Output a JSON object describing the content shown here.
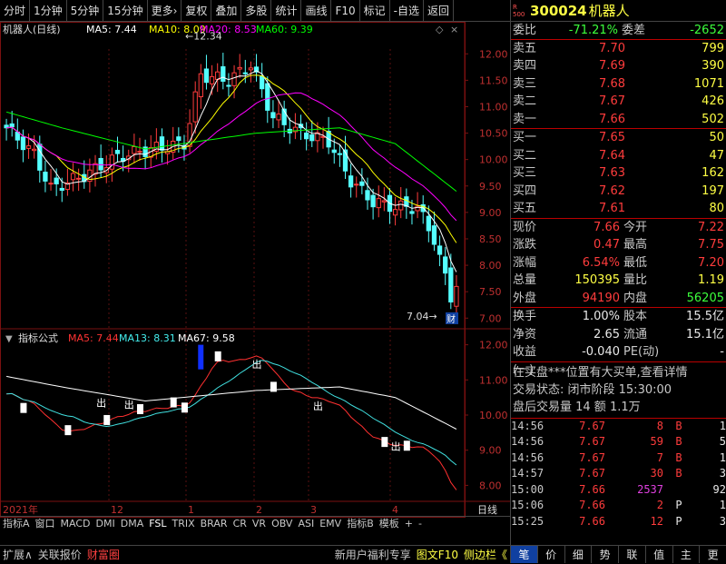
{
  "toolbar": {
    "items": [
      "分时",
      "1分钟",
      "5分钟",
      "15分钟",
      "更多›",
      "复权",
      "叠加",
      "多股",
      "统计",
      "画线",
      "F10",
      "标记",
      "-自选",
      "返回"
    ]
  },
  "main": {
    "title": "机器人(日线)",
    "ma5": "MA5: 7.44",
    "ma10": "MA10: 8.09",
    "ma20": "MA20: 8.53",
    "ma60": "MA60: 9.39",
    "yticks": [
      "12.00",
      "11.50",
      "11.00",
      "10.50",
      "10.00",
      "9.50",
      "9.00",
      "8.50",
      "8.00",
      "7.50",
      "7.00"
    ],
    "high_label": "12.34",
    "low_label": "7.04",
    "cai_label": "财"
  },
  "sub": {
    "title": "指标公式",
    "ma5": "MA5: 7.44",
    "ma13": "MA13: 8.31",
    "ma67": "MA67: 9.58",
    "yticks": [
      "12.00",
      "11.00",
      "10.00",
      "9.00",
      "8.00"
    ],
    "out_label": "出"
  },
  "xaxis": {
    "labels": [
      "2021年",
      "12",
      "1",
      "2",
      "3",
      "4"
    ],
    "period": "日线"
  },
  "tabbar": [
    "指标A",
    "窗口",
    "MACD",
    "DMI",
    "DMA",
    "FSL",
    "TRIX",
    "BRAR",
    "CR",
    "VR",
    "OBV",
    "ASI",
    "EMV",
    "指标B",
    "模板",
    "+",
    "-"
  ],
  "bottombar": {
    "left": [
      "扩展∧",
      "关联报价",
      "财富圈"
    ],
    "right": [
      "新用户福利专享",
      "图文F10",
      "侧边栏《"
    ]
  },
  "stock": {
    "badge": "R 500",
    "code": "300024",
    "name": "机器人"
  },
  "weibi": {
    "label": "委比",
    "value": "-71.21%",
    "label2": "委差",
    "value2": "-2652"
  },
  "sells": [
    {
      "l": "卖五",
      "p": "7.70",
      "v": "799"
    },
    {
      "l": "卖四",
      "p": "7.69",
      "v": "390"
    },
    {
      "l": "卖三",
      "p": "7.68",
      "v": "1071"
    },
    {
      "l": "卖二",
      "p": "7.67",
      "v": "426"
    },
    {
      "l": "卖一",
      "p": "7.66",
      "v": "502"
    }
  ],
  "buys": [
    {
      "l": "买一",
      "p": "7.65",
      "v": "50"
    },
    {
      "l": "买二",
      "p": "7.64",
      "v": "47"
    },
    {
      "l": "买三",
      "p": "7.63",
      "v": "162"
    },
    {
      "l": "买四",
      "p": "7.62",
      "v": "197"
    },
    {
      "l": "买五",
      "p": "7.61",
      "v": "80"
    }
  ],
  "quote": [
    {
      "a": "现价",
      "av": "7.66",
      "b": "今开",
      "bv": "7.22"
    },
    {
      "a": "涨跌",
      "av": "0.47",
      "b": "最高",
      "bv": "7.75"
    },
    {
      "a": "涨幅",
      "av": "6.54%",
      "b": "最低",
      "bv": "7.20"
    },
    {
      "a": "总量",
      "av": "150395",
      "b": "量比",
      "bv": "1.19"
    },
    {
      "a": "外盘",
      "av": "94190",
      "b": "内盘",
      "bv": "56205"
    }
  ],
  "fund": [
    {
      "a": "换手",
      "av": "1.00%",
      "b": "股本",
      "bv": "15.5亿"
    },
    {
      "a": "净资",
      "av": "2.65",
      "b": "流通",
      "bv": "15.1亿"
    },
    {
      "a": "收益(一)",
      "av": "-0.040",
      "b": "PE(动)",
      "bv": "-"
    }
  ],
  "notice": "在买盘***位置有大买单,查看详情",
  "status": "交易状态: 闭市阶段 15:30:00",
  "after": "盘后交易量 14 额 1.1万",
  "trades": [
    {
      "t": "14:56",
      "p": "7.67",
      "v": "8",
      "s": "B",
      "n": "1"
    },
    {
      "t": "14:56",
      "p": "7.67",
      "v": "59",
      "s": "B",
      "n": "5"
    },
    {
      "t": "14:56",
      "p": "7.67",
      "v": "7",
      "s": "B",
      "n": "1"
    },
    {
      "t": "14:57",
      "p": "7.67",
      "v": "30",
      "s": "B",
      "n": "3"
    },
    {
      "t": "15:00",
      "p": "7.66",
      "v": "2537",
      "s": "",
      "n": "92"
    },
    {
      "t": "15:06",
      "p": "7.66",
      "v": "2",
      "s": "P",
      "n": "1"
    },
    {
      "t": "15:25",
      "p": "7.66",
      "v": "12",
      "s": "P",
      "n": "3"
    }
  ],
  "tabs": [
    "笔",
    "价",
    "细",
    "势",
    "联",
    "值",
    "主",
    "更"
  ],
  "colors": {
    "up": "#ff3c3c",
    "down": "#54ffff",
    "ma5": "#ffffff",
    "ma10": "#ffff00",
    "ma20": "#ff00ff",
    "ma60": "#00ff00"
  }
}
